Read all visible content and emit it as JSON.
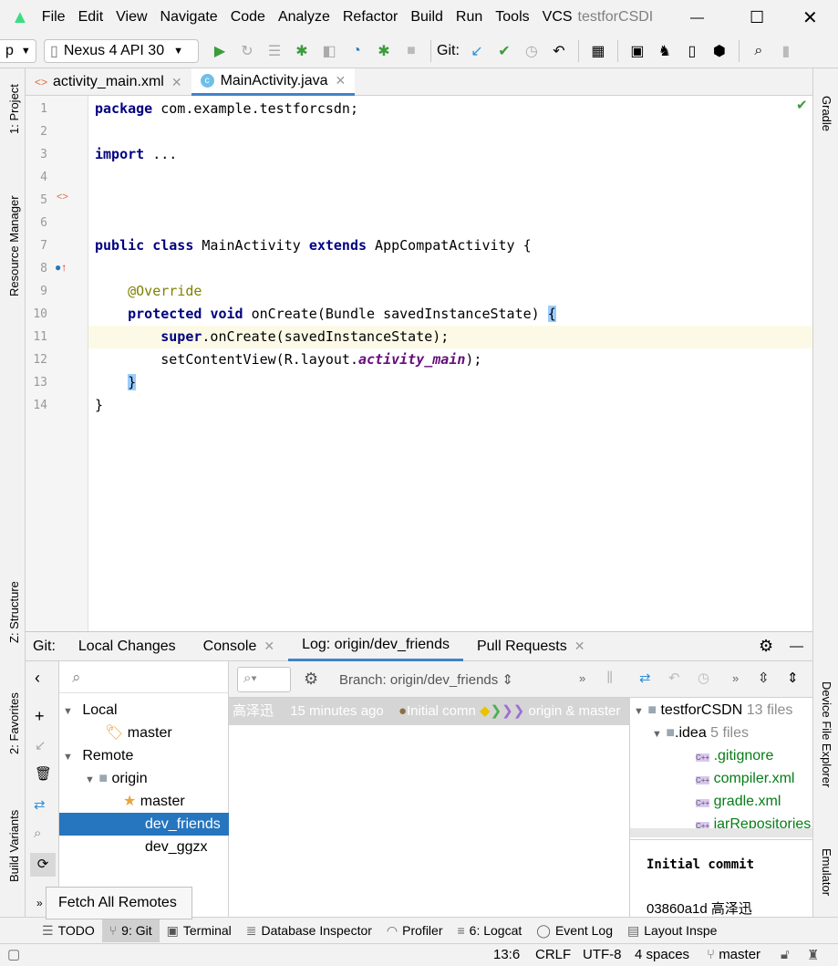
{
  "menu": {
    "items": [
      "File",
      "Edit",
      "View",
      "Navigate",
      "Code",
      "Analyze",
      "Refactor",
      "Build",
      "Run",
      "Tools",
      "VCS"
    ],
    "project_title": "testforCSDI"
  },
  "toolbar": {
    "module": "p",
    "device": "Nexus 4 API 30",
    "git_label": "Git:"
  },
  "editor_tabs": [
    {
      "label": "activity_main.xml",
      "active": false
    },
    {
      "label": "MainActivity.java",
      "active": true
    }
  ],
  "editor": {
    "lines": [
      {
        "n": "1",
        "code": "package com.example.testforcsdn;"
      },
      {
        "n": "2",
        "code": ""
      },
      {
        "n": "3",
        "code": "import ..."
      },
      {
        "n": "4",
        "code": ""
      },
      {
        "n": "5",
        "code": ""
      },
      {
        "n": "6",
        "code": ""
      },
      {
        "n": "7",
        "code": "public class MainActivity extends AppCompatActivity {"
      },
      {
        "n": "8",
        "code": ""
      },
      {
        "n": "9",
        "code": "    @Override"
      },
      {
        "n": "10",
        "code": "    protected void onCreate(Bundle savedInstanceState) {"
      },
      {
        "n": "11",
        "code": "        super.onCreate(savedInstanceState);"
      },
      {
        "n": "12",
        "code": "        setContentView(R.layout.activity_main);"
      },
      {
        "n": "13",
        "code": "    }"
      },
      {
        "n": "14",
        "code": "}"
      }
    ]
  },
  "left_strip": [
    "1: Project",
    "Resource Manager",
    "Z: Structure",
    "2: Favorites",
    "Build Variants"
  ],
  "right_strip": [
    "Gradle",
    "Device File Explorer",
    "Emulator"
  ],
  "git_panel": {
    "tabs": [
      {
        "label": "Git:"
      },
      {
        "label": "Local Changes"
      },
      {
        "label": "Console"
      },
      {
        "label": "Log: origin/dev_friends",
        "active": true
      },
      {
        "label": "Pull Requests"
      }
    ],
    "branches": {
      "local": "Local",
      "local_master": "master",
      "remote": "Remote",
      "origin": "origin",
      "origin_master": "master",
      "dev_friends": "dev_friends",
      "dev_ggzx": "dev_ggzx"
    },
    "branch_filter": "Branch: origin/dev_friends",
    "commit": {
      "author": "高泽迅",
      "time": "15 minutes ago",
      "message": "Initial comn",
      "refs": "origin & master"
    },
    "files": {
      "root": "testforCSDN",
      "root_count": "13 files",
      "idea": ".idea",
      "idea_count": "5 files",
      "items": [
        ".gitignore",
        "compiler.xml",
        "gradle.xml",
        "jarRepositories"
      ]
    },
    "details": {
      "message": "Initial commit",
      "hash_author": "03860a1d 高泽迅"
    },
    "tooltip": "Fetch All Remotes"
  },
  "tool_windows": [
    {
      "label": "TODO"
    },
    {
      "label": "9: Git",
      "active": true
    },
    {
      "label": "Terminal"
    },
    {
      "label": "Database Inspector"
    },
    {
      "label": "Profiler"
    },
    {
      "label": "6: Logcat"
    },
    {
      "label": "Event Log"
    },
    {
      "label": "Layout Inspe"
    }
  ],
  "status": {
    "position": "13:6",
    "line_sep": "CRLF",
    "encoding": "UTF-8",
    "indent": "4 spaces",
    "branch": "master"
  },
  "colors": {
    "accent": "#4083c9",
    "selection": "#2675bf",
    "keyword": "#000080",
    "annotation": "#808000"
  }
}
